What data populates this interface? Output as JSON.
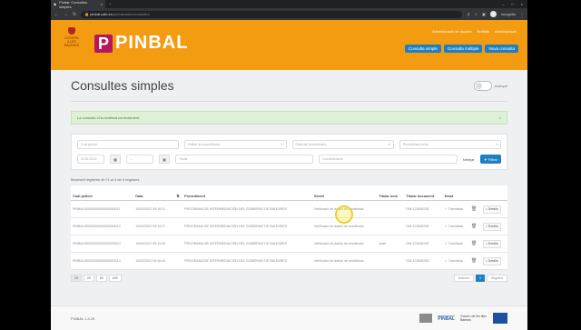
{
  "browser": {
    "tab_title": "Pinbal: Consultes simples",
    "url_host": "pinbal.caib.es",
    "url_path": "/pinbaladmin/consultes",
    "profile_label": "Incognito"
  },
  "header": {
    "logo_text": "PINBAL",
    "escudo_text": "GOVERN ILLES BALEARS",
    "top_links": [
      "Administració de usuaris",
      "Entitats",
      "Administració"
    ],
    "nav_buttons": [
      "Consulta simple",
      "Consulta múltiple",
      "Nova consulta"
    ]
  },
  "page": {
    "title": "Consultes simples",
    "toggle_label": "Avançat"
  },
  "alert": {
    "text": "La consulta s'ha realitzat correctament."
  },
  "filters": {
    "row1": [
      "Codi petició",
      "Entitat de procediment",
      "Estat del procediment",
      "Procediment actiu"
    ],
    "date_from": "01/01/2022",
    "date_to": "—",
    "row2_fields": [
      "Titular",
      "Documentació"
    ],
    "clear_label": "Netejar",
    "filter_label": "Filtrar"
  },
  "results": {
    "count_text": "Mostrant registres de l'1 al 4 de 4 registres",
    "columns": [
      "Codi petició",
      "Data",
      "",
      "Procediment",
      "Servei",
      "Titular nom",
      "Titular document",
      "Estat",
      "",
      ""
    ],
    "rows": [
      {
        "code": "PINBAL00000000000000000011",
        "date": "10/02/2022 09:10:21",
        "proc": "PROGRAMA DE INTERMEDIACIÓN DEL GOBIERNO DE BALEARES",
        "servei": "Verificació de dades de residència",
        "nom": "",
        "doc": "DNI 12345678Z",
        "estat": "✓ Tramitada",
        "action": "Detalls"
      },
      {
        "code": "PINBAL00000000000000000012",
        "date": "10/02/2022 09:12:27",
        "proc": "PROGRAMA DE INTERMEDIACIÓN DEL GOBIERNO DE BALEARES",
        "servei": "Verificació de dades de residència",
        "nom": "",
        "doc": "DNI 12345678Z",
        "estat": "✓ Tramitada",
        "action": "Detalls"
      },
      {
        "code": "PINBAL00000000000000000013",
        "date": "10/02/2022 09:14:05",
        "proc": "PROGRAMA DE INTERMEDIACIÓN DEL GOBIERNO DE BALEARES",
        "servei": "Verificació de dades de residència",
        "nom": "Joan",
        "doc": "DNI 12345678Z",
        "estat": "✓ Tramitada",
        "action": "Detalls"
      },
      {
        "code": "PINBAL00000000000000000014",
        "date": "10/02/2022 09:16:44",
        "proc": "PROGRAMA DE INTERMEDIACIÓN DEL GOBIERNO DE BALEARES",
        "servei": "Verificació de dades de residència",
        "nom": "",
        "doc": "DNI 12345678Z",
        "estat": "✓ Tramitada",
        "action": "Detalls"
      }
    ]
  },
  "pagination": {
    "sizes": [
      "10",
      "20",
      "50",
      "100"
    ],
    "prev": "Anterior",
    "current": "1",
    "next": "Següent"
  },
  "footer": {
    "version": "PINBAL 1.4.25",
    "gov_text": "Govern de les Illes Balears",
    "eu_text": "Fons Europeu"
  },
  "colors": {
    "header_orange": "#f39c12",
    "accent_blue": "#1f7fc0",
    "logo_magenta": "#b5175a",
    "alert_green": "#dff0d8"
  }
}
